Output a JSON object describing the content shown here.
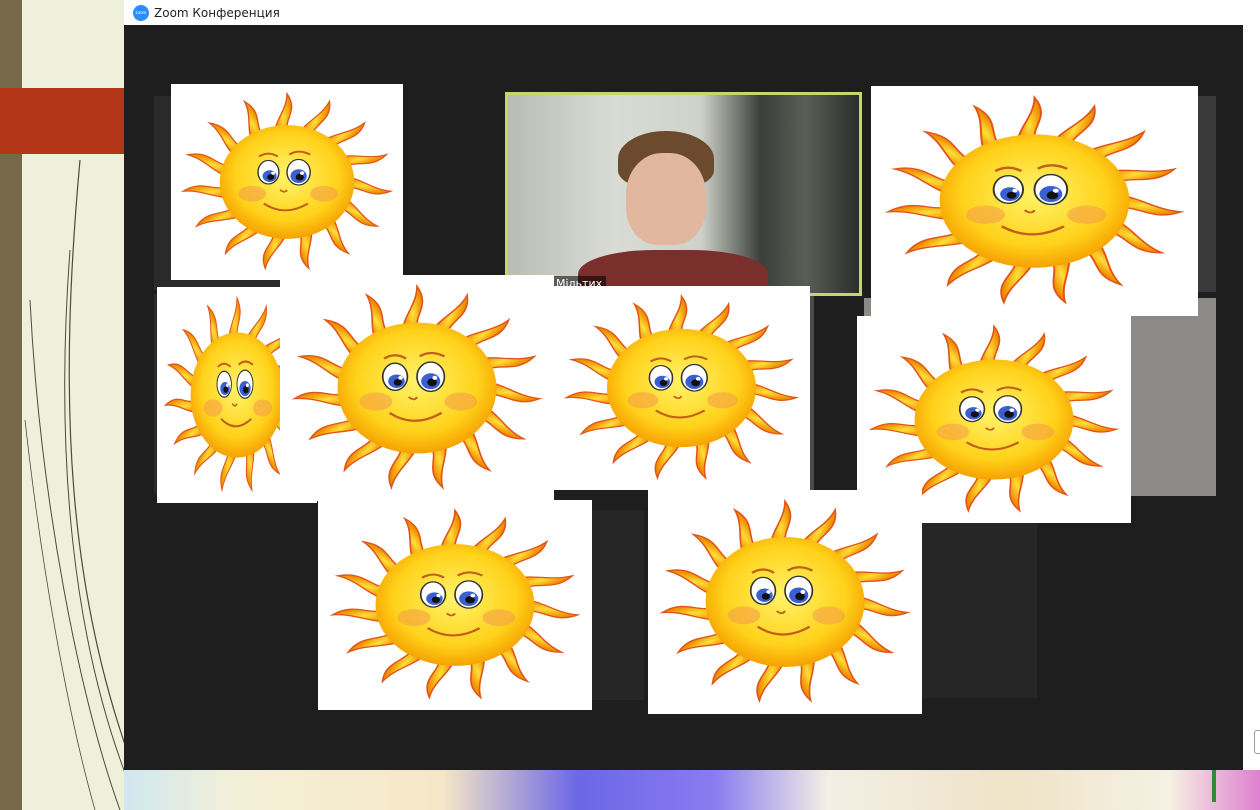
{
  "window": {
    "title": "Zoom Конференция",
    "logo_text": "zoom"
  },
  "speaker": {
    "name_label": "Мільтих"
  },
  "stickers": [
    {
      "name": "sun"
    },
    {
      "name": "sun"
    },
    {
      "name": "sun"
    },
    {
      "name": "sun"
    },
    {
      "name": "sun"
    },
    {
      "name": "sun"
    },
    {
      "name": "sun"
    },
    {
      "name": "sun"
    }
  ],
  "colors": {
    "zoom_blue": "#2d8cff",
    "active_speaker_border": "#c5d76a",
    "gallery_background": "#1e1e1e",
    "slide_accent": "#b23617"
  }
}
